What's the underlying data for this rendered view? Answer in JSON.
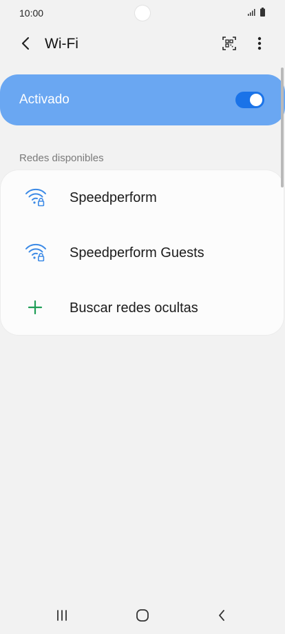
{
  "status_bar": {
    "time": "10:00"
  },
  "header": {
    "title": "Wi-Fi"
  },
  "master_toggle": {
    "label": "Activado",
    "state": "on"
  },
  "available_section": {
    "label": "Redes disponibles"
  },
  "networks": [
    {
      "ssid": "Speedperform",
      "icon": "wifi-locked-icon"
    },
    {
      "ssid": "Speedperform Guests",
      "icon": "wifi-locked-icon"
    },
    {
      "ssid": "Buscar redes ocultas",
      "icon": "plus-icon"
    }
  ],
  "colors": {
    "accent": "#1a73e8",
    "toggle_card": "#6aa7f2",
    "wifi_icon": "#3c8ae6",
    "plus_icon": "#1e9e56"
  }
}
